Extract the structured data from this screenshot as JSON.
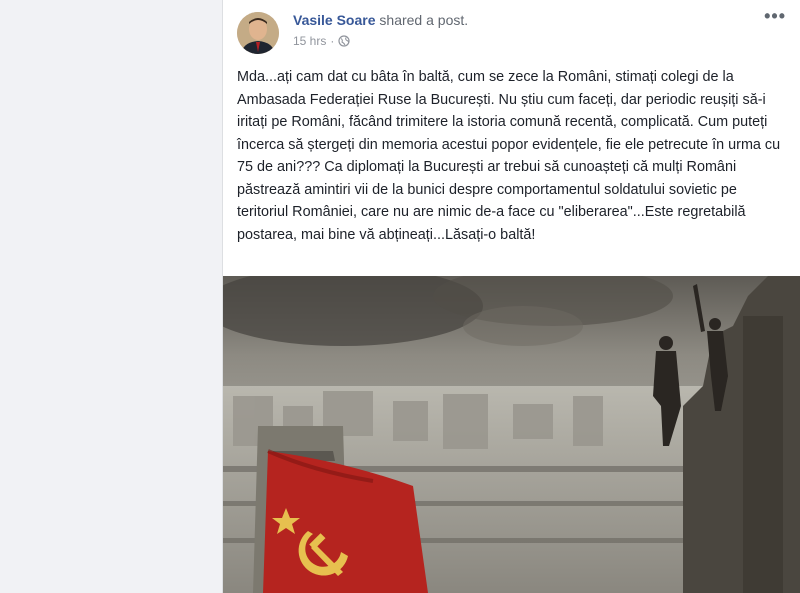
{
  "post": {
    "author": "Vasile Soare",
    "action": "shared a post.",
    "timestamp": "15 hrs",
    "separator": "·",
    "privacy_icon": "globe-icon",
    "more_label": "•••",
    "text": "Mda...ați cam dat cu bâta în baltă, cum se zece la Români, stimați colegi de la Ambasada Federației Ruse la București. Nu știu cum faceți, dar periodic reușiți să-i iritați pe Români, făcând trimitere la istoria comună recentă, complicată. Cum puteți încerca să ștergeți din memoria acestui popor evidențele, fie ele petrecute în urma cu 75 de ani??? Ca diplomați la București ar trebui să cunoașteți că mulți Români păstrează amintiri vii de la bunici despre comportamentul soldatului sovietic pe teritoriul României, care nu are nimic de-a face cu \"eliberarea\"...Este regretabilă postarea, mai bine vă abțineați...Lăsați-o baltă!"
  },
  "colors": {
    "author_link": "#385898",
    "meta_text": "#90949c",
    "body_text": "#1d2129",
    "flag_red": "#b5241f"
  }
}
